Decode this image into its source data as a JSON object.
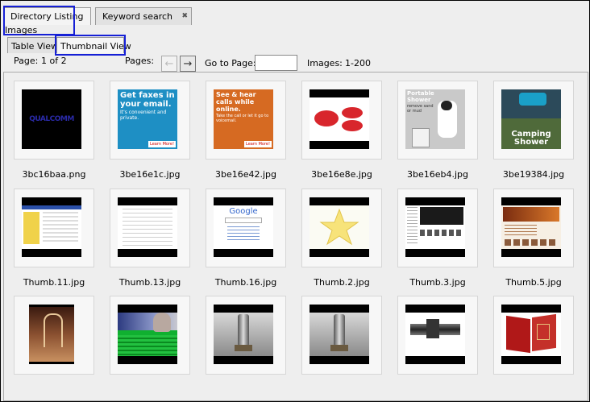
{
  "outer_tabs": [
    {
      "label": "Directory Listing",
      "active": true
    },
    {
      "label": "Keyword search",
      "active": false
    }
  ],
  "section_title": "Images",
  "inner_tabs": [
    {
      "label": "Table View",
      "active": false
    },
    {
      "label": "Thumbnail View",
      "active": true
    }
  ],
  "toolbar": {
    "page_label": "Page:",
    "page_value": "1 of 2",
    "pages_label": "Pages:",
    "goto_label": "Go to Page:",
    "goto_value": "",
    "images_label": "Images:",
    "images_value": "1-200",
    "prev_enabled": false,
    "next_enabled": true
  },
  "thumbnails": [
    {
      "name": "3bc16baa.png",
      "icon": "qualcomm-logo-thumbnail"
    },
    {
      "name": "3be16e1c.jpg",
      "icon": "fax-ad-thumbnail"
    },
    {
      "name": "3be16e42.jpg",
      "icon": "voicemail-ad-thumbnail"
    },
    {
      "name": "3be16e8e.jpg",
      "icon": "red-logo-thumbnail"
    },
    {
      "name": "3be16eb4.jpg",
      "icon": "portable-shower-dog-thumbnail"
    },
    {
      "name": "3be19384.jpg",
      "icon": "camping-shower-thumbnail"
    },
    {
      "name": "Thumb.11.jpg",
      "icon": "ebay-page-thumbnail"
    },
    {
      "name": "Thumb.13.jpg",
      "icon": "document-page-thumbnail"
    },
    {
      "name": "Thumb.16.jpg",
      "icon": "google-page-thumbnail"
    },
    {
      "name": "Thumb.2.jpg",
      "icon": "star-thumbnail"
    },
    {
      "name": "Thumb.3.jpg",
      "icon": "dark-webpage-thumbnail"
    },
    {
      "name": "Thumb.5.jpg",
      "icon": "orange-webpage-thumbnail"
    },
    {
      "name": "",
      "icon": "cathedral-thumbnail"
    },
    {
      "name": "",
      "icon": "glitched-portrait-thumbnail"
    },
    {
      "name": "",
      "icon": "metal-part-thumbnail"
    },
    {
      "name": "",
      "icon": "metal-part-thumbnail"
    },
    {
      "name": "",
      "icon": "machine-part-thumbnail"
    },
    {
      "name": "",
      "icon": "red-book-thumbnail"
    }
  ],
  "text_snippets": {
    "fax_ad": "Get faxes in your email.",
    "fax_sub": "It's convenient and private.",
    "voicemail_ad": "See & hear calls while online.",
    "voicemail_sub": "Take the call or let it go to voicemail.",
    "learn_more": "Learn More!",
    "qualcomm": "QUALCOMM",
    "portable_shower": "Portable Shower",
    "portable_shower_sub": "remove sand or mud",
    "camping_shower": "Camping Shower",
    "google": "Google"
  },
  "colors": {
    "highlight": "#1620d6",
    "fax_ad_bg": "#1e8fc4",
    "voicemail_ad_bg": "#d66a22",
    "qualcomm_blue": "#2a2aa8"
  }
}
